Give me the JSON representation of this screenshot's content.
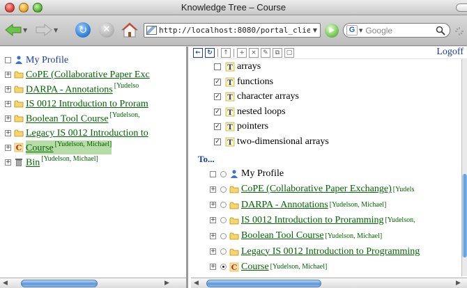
{
  "window": {
    "title": "Knowledge Tree – Course"
  },
  "toolbar": {
    "url": "http://localhost:8080/portal_clie",
    "search_placeholder": "Google",
    "search_engine_letter": "G"
  },
  "left_tree": {
    "items": [
      {
        "label": "My Profile",
        "author": "",
        "icon": "person-icon",
        "expander": "none"
      },
      {
        "label": "CoPE (Collaborative Paper Exc",
        "author": "",
        "icon": "folder-icon",
        "expander": "plus"
      },
      {
        "label": "DARPA - Annotations",
        "author": "[Yudelso",
        "icon": "folder-icon",
        "expander": "plus"
      },
      {
        "label": "IS 0012 Introduction to Proram",
        "author": "",
        "icon": "folder-icon",
        "expander": "plus"
      },
      {
        "label": "Boolean Tool Course",
        "author": "[Yudelson,",
        "icon": "folder-icon",
        "expander": "plus"
      },
      {
        "label": "Legacy IS 0012 Introduction to",
        "author": "",
        "icon": "folder-icon",
        "expander": "plus"
      },
      {
        "label": "Course",
        "author": "[Yudelson, Michael]",
        "icon": "course-icon",
        "expander": "plus",
        "selected": true
      },
      {
        "label": "Bin",
        "author": "[Yudelson, Michael]",
        "icon": "trash-icon",
        "expander": "plus"
      }
    ]
  },
  "right_panel": {
    "logoff_label": "Logoff",
    "concepts": [
      {
        "label": "arrays",
        "checked": false
      },
      {
        "label": "functions",
        "checked": true
      },
      {
        "label": "character arrays",
        "checked": true
      },
      {
        "label": "nested loops",
        "checked": true
      },
      {
        "label": "pointers",
        "checked": true
      },
      {
        "label": "two-dimensional arrays",
        "checked": true
      }
    ],
    "to_label": "To...",
    "targets": [
      {
        "label": "My Profile",
        "author": "",
        "icon": "person-icon",
        "expander": "none",
        "radio": false
      },
      {
        "label": "CoPE (Collaborative Paper Exchange)",
        "author": "[Yudels",
        "icon": "folder-icon",
        "expander": "plus",
        "radio": false
      },
      {
        "label": "DARPA - Annotations",
        "author": "[Yudelson, Michael]",
        "icon": "folder-icon",
        "expander": "plus",
        "radio": false
      },
      {
        "label": "IS 0012 Introduction to Proramming",
        "author": "[Yudelson,",
        "icon": "folder-icon",
        "expander": "plus",
        "radio": false
      },
      {
        "label": "Boolean Tool Course",
        "author": "[Yudelson, Michael]",
        "icon": "folder-icon",
        "expander": "plus",
        "radio": false
      },
      {
        "label": "Legacy IS 0012 Introduction to Programming",
        "author": "",
        "icon": "folder-icon",
        "expander": "plus",
        "radio": false
      },
      {
        "label": "Course",
        "author": "[Yudelson, Michael]",
        "icon": "course-icon",
        "expander": "plus",
        "radio": true
      }
    ]
  },
  "colors": {
    "link_green": "#006400",
    "link_blue": "#1a3aaa",
    "selection": "#b8dca8"
  }
}
